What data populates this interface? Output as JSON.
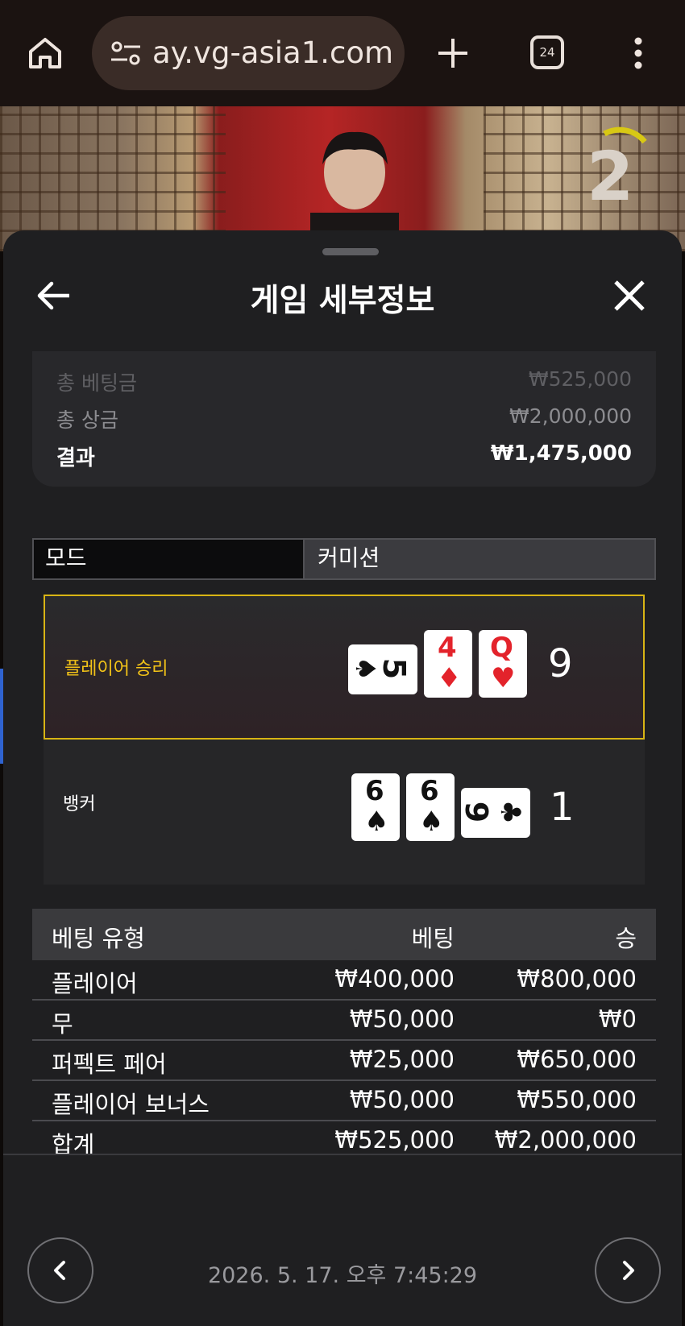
{
  "browser": {
    "url": "ay.vg-asia1.com",
    "tab_count": "24",
    "icons": [
      "home-icon",
      "site-settings-icon",
      "new-tab-plus-icon",
      "tab-switcher-icon",
      "overflow-menu-icon"
    ]
  },
  "video": {
    "countdown": "2"
  },
  "sheet": {
    "title": "게임 세부정보",
    "summary": {
      "total_bet_label": "총 베팅금",
      "total_bet_value": "₩525,000",
      "total_prize_label": "총 상금",
      "total_prize_value": "₩2,000,000",
      "result_label": "결과",
      "result_value": "₩1,475,000"
    },
    "mode": {
      "left_label": "모드",
      "right_label": "커미션"
    },
    "player": {
      "label": "플레이어 승리",
      "score": "9",
      "cards": [
        {
          "rank": "5",
          "suit": "♠",
          "color": "#121212",
          "orientation": "horizontal"
        },
        {
          "rank": "4",
          "suit": "♦",
          "color": "#e3232b",
          "orientation": "vertical"
        },
        {
          "rank": "Q",
          "suit": "♥",
          "color": "#e3232b",
          "orientation": "vertical"
        }
      ]
    },
    "banker": {
      "label": "뱅커",
      "score": "1",
      "cards": [
        {
          "rank": "6",
          "suit": "♠",
          "color": "#121212",
          "orientation": "vertical"
        },
        {
          "rank": "6",
          "suit": "♠",
          "color": "#121212",
          "orientation": "vertical"
        },
        {
          "rank": "9",
          "suit": "♣",
          "color": "#121212",
          "orientation": "horizontal"
        }
      ]
    },
    "bets": {
      "headers": [
        "베팅 유형",
        "베팅",
        "승"
      ],
      "rows": [
        {
          "type": "플레이어",
          "bet": "₩400,000",
          "win": "₩800,000"
        },
        {
          "type": "무",
          "bet": "₩50,000",
          "win": "₩0"
        },
        {
          "type": "퍼펙트 페어",
          "bet": "₩25,000",
          "win": "₩650,000"
        },
        {
          "type": "플레이어 보너스",
          "bet": "₩50,000",
          "win": "₩550,000"
        },
        {
          "type": "합계",
          "bet": "₩525,000",
          "win": "₩2,000,000"
        }
      ]
    },
    "datetime": "2026. 5. 17. 오후 7:45:29"
  },
  "colors": {
    "accent_gold": "#d8b414",
    "player_label": "#f2c318",
    "sheet_bg": "#1f1f21",
    "trophy_tab": "#2f63d0"
  }
}
